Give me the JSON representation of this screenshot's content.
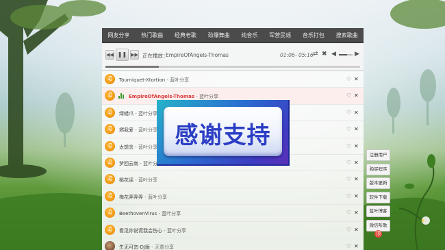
{
  "nav": {
    "items": [
      "网友分享",
      "热门歌曲",
      "经典老歌",
      "劲爆舞曲",
      "纯音乐",
      "军营民谣",
      "音乐打包",
      "搜索歌曲"
    ]
  },
  "player": {
    "now_label": "正在播放：",
    "now_title": "EmpireOfAngels-Thomas",
    "time_current": "01:06",
    "time_sep": "-",
    "time_total": "05:16",
    "progress": 0.21,
    "volume": 0.6
  },
  "songs": [
    {
      "title": "Tourniquet-Xtortion",
      "sep": " - ",
      "artist": "蓝叶分享"
    },
    {
      "title": "EmpireOfAngels-Thomas",
      "sep": " - ",
      "artist": "蓝叶分享",
      "active": true
    },
    {
      "title": "绿蜡爪",
      "sep": " - ",
      "artist": "蓝叶分享"
    },
    {
      "title": "燃我爱",
      "sep": " - ",
      "artist": "蓝叶分享"
    },
    {
      "title": "太想念",
      "sep": " - ",
      "artist": "蓝叶分享"
    },
    {
      "title": "梦回云南",
      "sep": " - ",
      "artist": "蓝叶分享"
    },
    {
      "title": "桃花谣",
      "sep": " - ",
      "artist": "蓝叶分享"
    },
    {
      "title": "梅花弄弄弄",
      "sep": " - ",
      "artist": "蓝叶分享"
    },
    {
      "title": "BeethovenVirus",
      "sep": " - ",
      "artist": "蓝叶分享"
    },
    {
      "title": "看见你说谎我会伤心",
      "sep": " - ",
      "artist": "蓝叶分享"
    },
    {
      "title": "生无可恋-DJ版",
      "sep": " - ",
      "artist": "天意分享"
    }
  ],
  "overlay": {
    "text": "感谢支持"
  },
  "side": {
    "items": [
      "注册用户",
      "购买程序",
      "版本更新",
      "软件下载",
      "蓝叶博客",
      "微信听歌"
    ],
    "top_label": "顶"
  },
  "colors": {
    "nav_bg": "#4b4b4b",
    "active_title": "#d93a3a",
    "avatar": "#f29a12"
  },
  "icons": {
    "prev": "prev-icon",
    "pause": "pause-icon",
    "next": "next-icon",
    "shuffle": "shuffle-icon",
    "loop": "loop-icon",
    "volume": "volume-icon",
    "heart": "heart-icon",
    "close": "close-icon",
    "music": "music-note-icon"
  }
}
